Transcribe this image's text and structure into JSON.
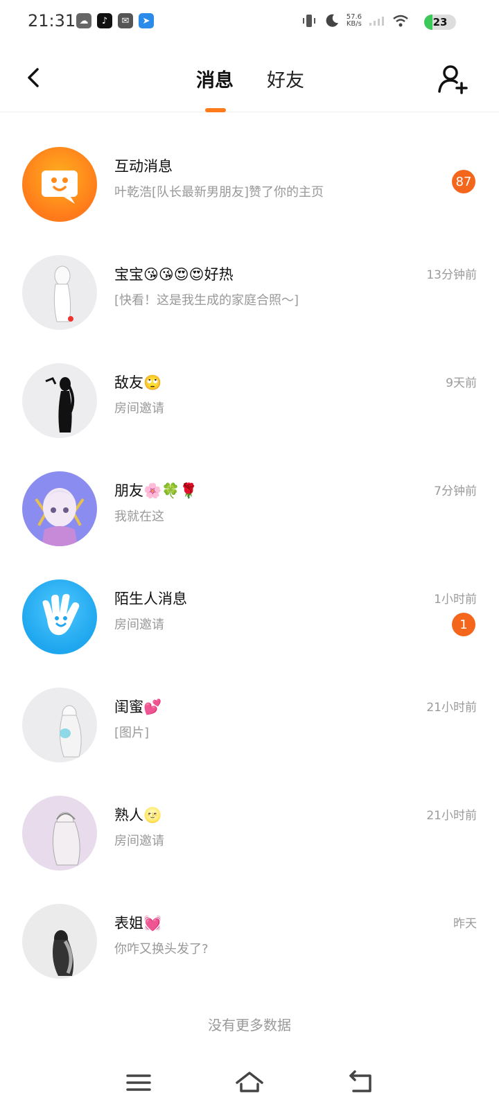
{
  "status_bar": {
    "time": "21:31",
    "net_speed_value": "57.6",
    "net_speed_unit": "KB/s",
    "battery": "23"
  },
  "header": {
    "tabs": [
      {
        "label": "消息",
        "active": true
      },
      {
        "label": "好友",
        "active": false
      }
    ]
  },
  "messages": [
    {
      "name": "互动消息",
      "preview": "叶乾浩[队长最新男朋友]赞了你的主页",
      "time": "",
      "badge": "87"
    },
    {
      "name": "宝宝😘😘😍😍好热",
      "preview": "[快看！这是我生成的家庭合照～]",
      "time": "13分钟前",
      "badge": ""
    },
    {
      "name": "敌友🙄",
      "preview": "房间邀请",
      "time": "9天前",
      "badge": ""
    },
    {
      "name": "朋友🌸🍀🌹",
      "preview": "我就在这",
      "time": "7分钟前",
      "badge": ""
    },
    {
      "name": "陌生人消息",
      "preview": "房间邀请",
      "time": "1小时前",
      "badge": "1"
    },
    {
      "name": "闺蜜💕",
      "preview": "[图片]",
      "time": "21小时前",
      "badge": ""
    },
    {
      "name": "熟人🌝",
      "preview": "房间邀请",
      "time": "21小时前",
      "badge": ""
    },
    {
      "name": "表姐💓",
      "preview": "你咋又换头发了?",
      "time": "昨天",
      "badge": ""
    }
  ],
  "footer": {
    "no_more": "没有更多数据"
  },
  "colors": {
    "accent": "#ff7a1a",
    "badge": "#f4661c"
  }
}
